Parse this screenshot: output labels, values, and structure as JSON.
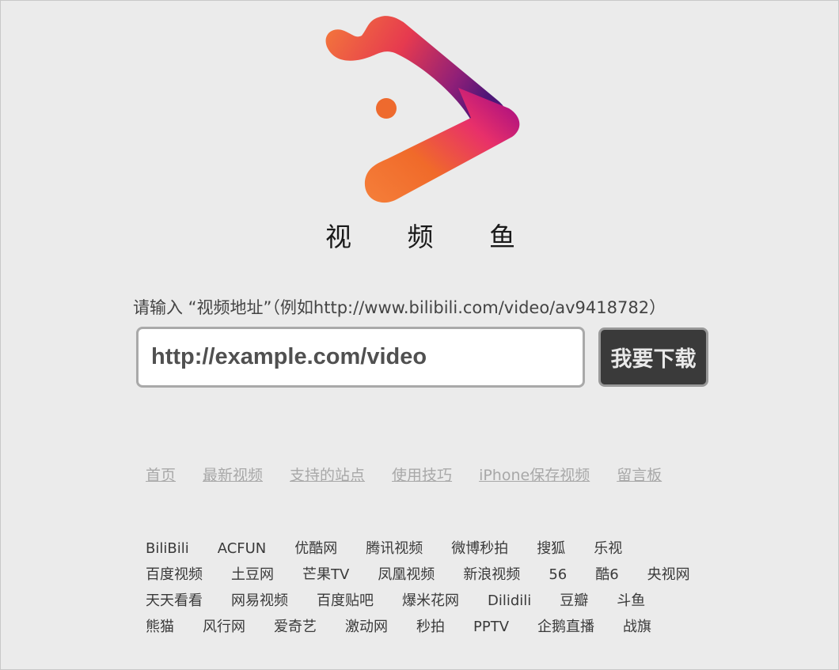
{
  "brand": {
    "name": "视 频 鱼"
  },
  "search": {
    "hint": "请输入 “视频地址”（例如http://www.bilibili.com/video/av9418782）",
    "placeholder": "http://example.com/video",
    "button_label": "我要下载"
  },
  "nav": {
    "items": [
      {
        "label": "首页"
      },
      {
        "label": "最新视频"
      },
      {
        "label": "支持的站点"
      },
      {
        "label": "使用技巧"
      },
      {
        "label": "iPhone保存视频"
      },
      {
        "label": "留言板"
      }
    ]
  },
  "sites": [
    "BiliBili",
    "ACFUN",
    "优酷网",
    "腾讯视频",
    "微博秒拍",
    "搜狐",
    "乐视",
    "百度视频",
    "土豆网",
    "芒果TV",
    "凤凰视频",
    "新浪视频",
    "56",
    "酷6",
    "央视网",
    "天天看看",
    "网易视频",
    "百度贴吧",
    "爆米花网",
    "Dilidili",
    "豆瓣",
    "斗鱼",
    "熊猫",
    "风行网",
    "爱奇艺",
    "激动网",
    "秒拍",
    "PPTV",
    "企鹅直播",
    "战旗"
  ],
  "colors": {
    "logo_orange": "#f07a33",
    "logo_red": "#e83a4a",
    "logo_magenta": "#c2167f",
    "logo_purple": "#5b1a7a",
    "button_bg": "#3a3a3a",
    "link_gray": "#a8a8a8"
  }
}
